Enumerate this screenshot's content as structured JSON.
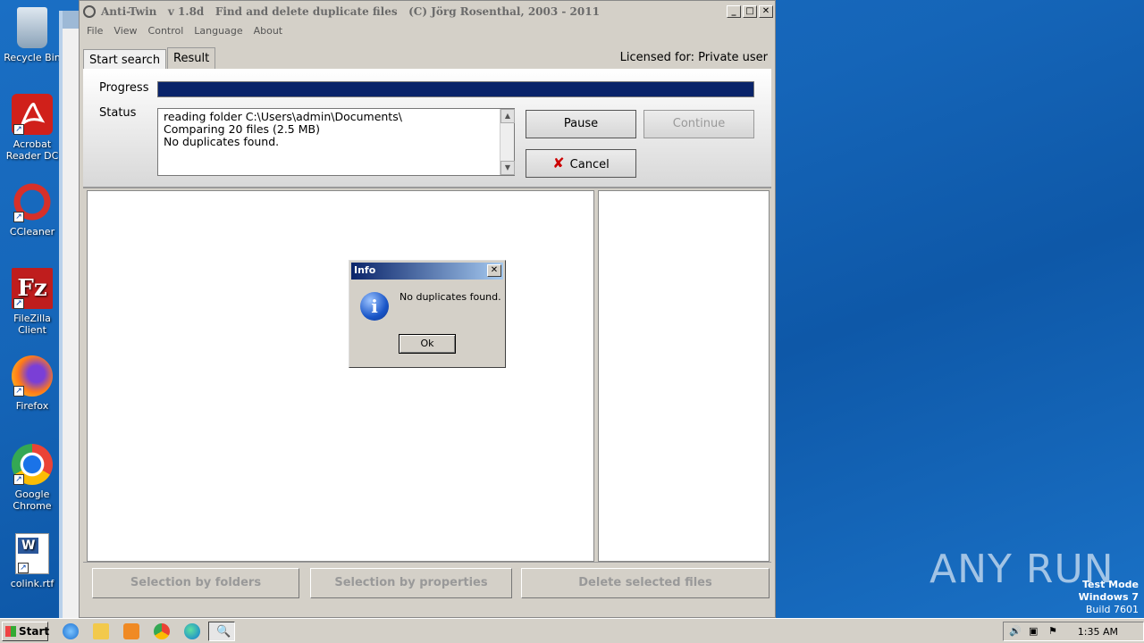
{
  "desktop": {
    "icons": [
      {
        "label": "Recycle Bin",
        "icon": "recycle-bin-icon"
      },
      {
        "label": "Acrobat Reader DC",
        "icon": "acrobat-icon"
      },
      {
        "label": "CCleaner",
        "icon": "ccleaner-icon"
      },
      {
        "label": "FileZilla Client",
        "icon": "filezilla-icon"
      },
      {
        "label": "Firefox",
        "icon": "firefox-icon"
      },
      {
        "label": "Google Chrome",
        "icon": "chrome-icon"
      },
      {
        "label": "colink.rtf",
        "icon": "word-document-icon"
      }
    ],
    "watermark": "ANY RUN",
    "test_mode": {
      "line1": "Test Mode",
      "line2": "Windows 7",
      "line3": "Build 7601"
    }
  },
  "window": {
    "title": "Anti-Twin   v 1.8d   Find and delete duplicate files   (C) Jörg Rosenthal, 2003 - 2011",
    "menu": [
      "File",
      "View",
      "Control",
      "Language",
      "About"
    ],
    "tabs": [
      "Start search",
      "Result"
    ],
    "licensed": "Licensed for: Private user",
    "progress_label": "Progress",
    "progress_fraction": 1.0,
    "status_label": "Status",
    "status_lines": [
      "reading folder C:\\Users\\admin\\Documents\\",
      "Comparing 20 files (2.5 MB)",
      "No duplicates found."
    ],
    "buttons": {
      "pause": "Pause",
      "continue": "Continue",
      "cancel": "Cancel"
    },
    "bottom_buttons": [
      "Selection by folders",
      "Selection by properties",
      "Delete selected files"
    ]
  },
  "dialog": {
    "title": "Info",
    "message": "No duplicates found.",
    "ok": "Ok"
  },
  "taskbar": {
    "start": "Start",
    "clock": "1:35 AM"
  }
}
